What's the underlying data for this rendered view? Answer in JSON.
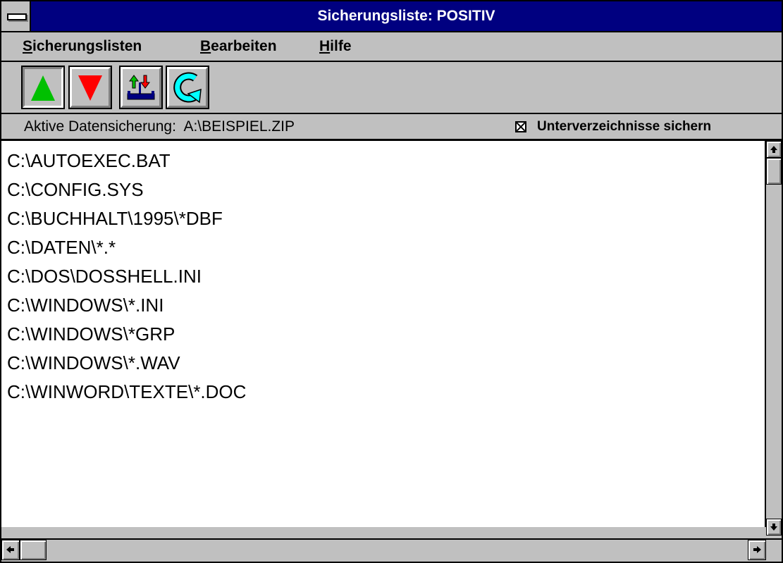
{
  "window": {
    "title": "Sicherungsliste: POSITIV"
  },
  "menu": {
    "items": [
      {
        "ul": "S",
        "rest": "icherungslisten"
      },
      {
        "ul": "B",
        "rest": "earbeiten"
      },
      {
        "ul": "H",
        "rest": "ilfe"
      }
    ]
  },
  "toolbar": {
    "buttons": [
      {
        "icon": "green-up-triangle-icon",
        "pressed": true
      },
      {
        "icon": "red-down-triangle-icon",
        "pressed": false
      },
      {
        "icon": "exchange-arrows-icon",
        "pressed": false
      },
      {
        "icon": "rotate-arrow-icon",
        "pressed": false
      }
    ]
  },
  "status": {
    "active_backup": "Aktive Datensicherung:  A:\\BEISPIEL.ZIP",
    "subdirs_checked": true,
    "subdirs_label": "Unterverzeichnisse sichern"
  },
  "list": {
    "items": [
      "C:\\AUTOEXEC.BAT",
      "C:\\CONFIG.SYS",
      "C:\\BUCHHALT\\1995\\*DBF",
      "C:\\DATEN\\*.*",
      "C:\\DOS\\DOSSHELL.INI",
      "C:\\WINDOWS\\*.INI",
      "C:\\WINDOWS\\*GRP",
      "C:\\WINDOWS\\*.WAV",
      "C:\\WINWORD\\TEXTE\\*.DOC"
    ]
  },
  "colors": {
    "titlebar": "#000080",
    "face": "#c0c0c0",
    "green": "#00c000",
    "red": "#ff0000",
    "cyan": "#00ffff",
    "navy": "#000080"
  }
}
